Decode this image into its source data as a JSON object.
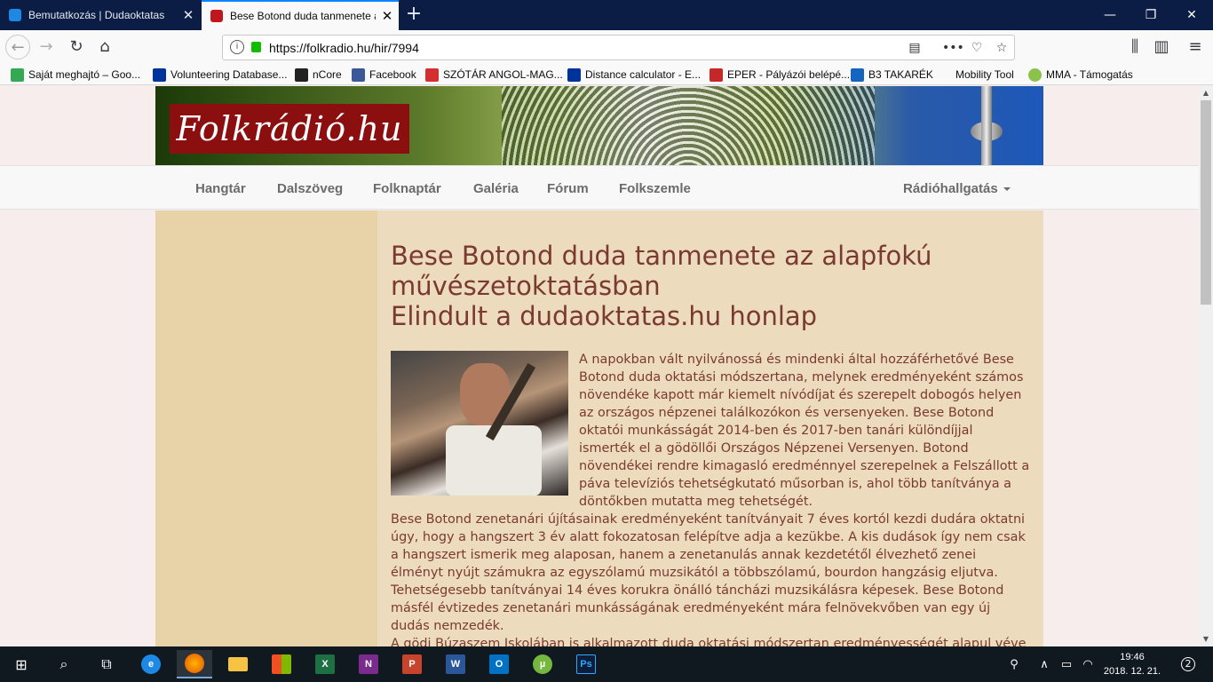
{
  "browser": {
    "tabs": [
      {
        "title": "Bemutatkozás | Dudaoktatas",
        "favicon_color": "#1e88e5"
      },
      {
        "title": "Bese Botond duda tanmenete a",
        "favicon_color": "#c0161c"
      }
    ],
    "url": "https://folkradio.hu/hir/7994",
    "bookmarks": [
      {
        "label": "Saját meghajtó – Goo...",
        "icon": "google-drive-icon",
        "color": "#34a853"
      },
      {
        "label": "Volunteering Database...",
        "icon": "eu-flag-icon",
        "color": "#003399"
      },
      {
        "label": "nCore",
        "icon": "ncore-icon",
        "color": "#222222"
      },
      {
        "label": "Facebook",
        "icon": "facebook-icon",
        "color": "#3b5998"
      },
      {
        "label": "SZÓTÁR ANGOL-MAG...",
        "icon": "dictionary-icon",
        "color": "#d32f2f"
      },
      {
        "label": "Distance calculator - E...",
        "icon": "eu-flag-icon",
        "color": "#003399"
      },
      {
        "label": "EPER - Pályázói belépé...",
        "icon": "eper-icon",
        "color": "#c62828"
      },
      {
        "label": "B3 TAKARÉK",
        "icon": "b3-icon",
        "color": "#1565c0"
      },
      {
        "label": "Mobility Tool",
        "icon": "",
        "color": ""
      },
      {
        "label": "MMA - Támogatás",
        "icon": "mma-icon",
        "color": "#8bc34a"
      }
    ]
  },
  "site": {
    "logo_text": "Folkrádió.hu",
    "menu": [
      "Hangtár",
      "Dalszöveg",
      "Folknaptár",
      "Galéria",
      "Fórum",
      "Folkszemle"
    ],
    "menu_right": "Rádióhallgatás"
  },
  "article": {
    "title_line1": "Bese Botond duda tanmenete az alapfokú",
    "title_line2": "művészetoktatásban",
    "title_line3": "Elindult a dudaoktatas.hu honlap",
    "paragraph1": "A napokban vált nyilvánossá és mindenki által hozzáférhetővé Bese Botond duda oktatási módszertana, melynek eredményeként számos növendéke kapott már kiemelt nívódíjat és szerepelt dobogós helyen az országos népzenei találkozókon és versenyeken. Bese Botond oktatói munkásságát 2014-ben és 2017-ben tanári különdíjjal ismerték el a gödöllői Országos Népzenei Versenyen. Botond növendékei rendre kimagasló eredménnyel szerepelnek a Felszállott a páva televíziós tehetségkutató műsorban is, ahol több tanítványa a döntőkben mutatta meg tehetségét.",
    "paragraph2": "Bese Botond zenetanári újításainak eredményeként tanítványait 7 éves kortól kezdi dudára oktatni úgy, hogy a hangszert 3 év alatt fokozatosan felépítve adja a kezükbe. A kis dudások így nem csak a hangszert ismerik meg alaposan, hanem a zenetanulás annak kezdetétől élvezhető zenei élményt nyújt számukra az egyszólamú muzsikától a többszólamú, bourdon hangzásig eljutva.",
    "paragraph3": "Tehetségesebb tanítványai 14 éves korukra önálló táncházi muzsikálásra képesek. Bese Botond másfél évtizedes zenetanári munkásságának eredményeként mára felnövekvőben van egy új dudás nemzedék.",
    "paragraph4": "A gödi Búzaszem Iskolában is alkalmazott duda oktatási módszertan eredményességét alapul véve"
  },
  "taskbar": {
    "apps": [
      {
        "name": "start",
        "icon": "windows-icon"
      },
      {
        "name": "search",
        "icon": "search-icon"
      },
      {
        "name": "task-view",
        "icon": "task-view-icon"
      },
      {
        "name": "edge",
        "icon": "edge-icon",
        "color": "#1e88e5",
        "glyph": "e"
      },
      {
        "name": "firefox",
        "icon": "firefox-icon",
        "color": "#ff6f00",
        "glyph": ""
      },
      {
        "name": "explorer",
        "icon": "folder-icon",
        "color": "#f6c343",
        "glyph": ""
      },
      {
        "name": "store",
        "icon": "store-icon",
        "color": "#ffffff",
        "glyph": ""
      },
      {
        "name": "excel",
        "icon": "excel-icon",
        "color": "#1d7044",
        "glyph": "X"
      },
      {
        "name": "onenote",
        "icon": "onenote-icon",
        "color": "#7b2b8d",
        "glyph": "N"
      },
      {
        "name": "powerpoint",
        "icon": "powerpoint-icon",
        "color": "#c7432b",
        "glyph": "P"
      },
      {
        "name": "word",
        "icon": "word-icon",
        "color": "#2b579a",
        "glyph": "W"
      },
      {
        "name": "outlook",
        "icon": "outlook-icon",
        "color": "#0072c6",
        "glyph": "O"
      },
      {
        "name": "utorrent",
        "icon": "utorrent-icon",
        "color": "#76b83f",
        "glyph": "µ"
      },
      {
        "name": "photoshop",
        "icon": "photoshop-icon",
        "color": "#0b1e3a",
        "glyph": "Ps"
      }
    ],
    "time": "19:46",
    "date": "2018. 12. 21.",
    "notifications": "2"
  }
}
